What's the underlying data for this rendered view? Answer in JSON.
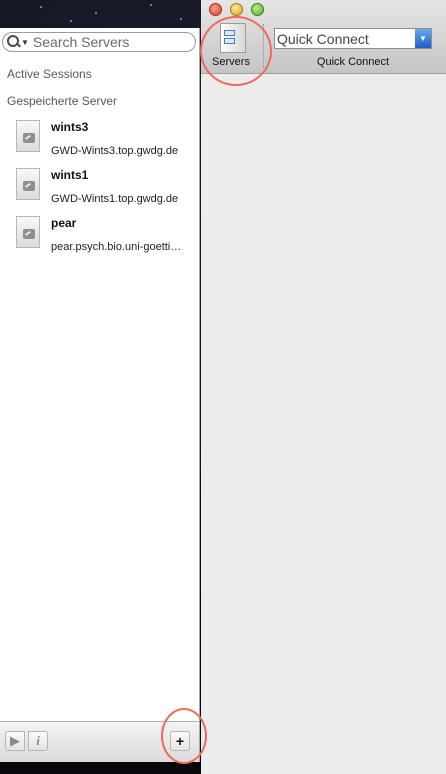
{
  "drawer": {
    "search": {
      "placeholder": "Search Servers"
    },
    "sections": {
      "active": "Active Sessions",
      "saved": "Gespeicherte Server"
    },
    "servers": [
      {
        "name": "wints3",
        "host": "GWD-Wints3.top.gwdg.de"
      },
      {
        "name": "wints1",
        "host": "GWD-Wints1.top.gwdg.de"
      },
      {
        "name": "pear",
        "host": "pear.psych.bio.uni-goettingen.de"
      }
    ],
    "bottom": {
      "play_icon": "play-icon",
      "info_label": "i",
      "add_label": "+"
    }
  },
  "toolbar": {
    "servers_label": "Servers",
    "quick_connect": {
      "placeholder": "Quick Connect",
      "label": "Quick Connect"
    }
  },
  "colors": {
    "annotation": "#ee6a5a",
    "combo_arrow": "#2f6fd1"
  }
}
